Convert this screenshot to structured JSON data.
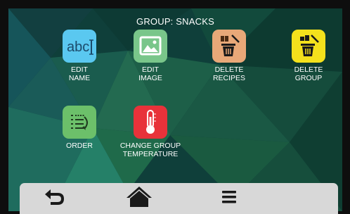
{
  "header": {
    "title": "GROUP: SNACKS"
  },
  "tiles": [
    {
      "icon": "abc-text-icon",
      "color": "#5ac8f0",
      "label_lines": [
        "EDIT",
        "NAME"
      ],
      "icon_text": "abc"
    },
    {
      "icon": "image-icon",
      "color": "#79c68a",
      "label_lines": [
        "EDIT",
        "IMAGE"
      ]
    },
    {
      "icon": "delete-recipes-icon",
      "color": "#e8a878",
      "label_lines": [
        "DELETE",
        "RECIPES"
      ]
    },
    {
      "icon": "delete-group-icon",
      "color": "#f4e11c",
      "label_lines": [
        "DELETE",
        "GROUP"
      ]
    },
    {
      "icon": "order-list-icon",
      "color": "#6cc06a",
      "label_lines": [
        "ORDER"
      ]
    },
    {
      "icon": "thermometer-icon",
      "color": "#e8323a",
      "label_lines": [
        "CHANGE GROUP",
        "TEMPERATURE"
      ]
    }
  ],
  "navbar": {
    "items": [
      {
        "icon": "back-arrow-icon"
      },
      {
        "icon": "home-icon"
      },
      {
        "icon": "menu-icon"
      }
    ]
  }
}
